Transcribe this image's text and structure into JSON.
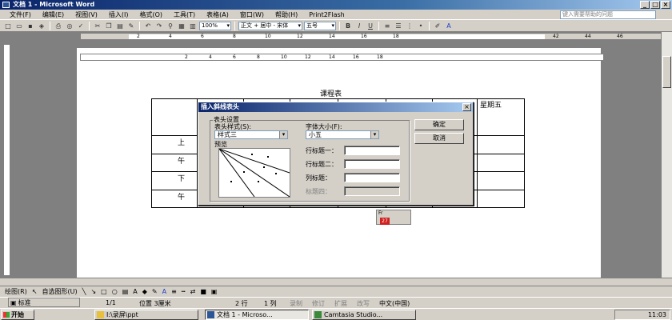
{
  "window": {
    "title": "文档 1 - Microsoft Word"
  },
  "menu": [
    "文件(F)",
    "编辑(E)",
    "视图(V)",
    "插入(I)",
    "格式(O)",
    "工具(T)",
    "表格(A)",
    "窗口(W)",
    "帮助(H)",
    "Print2Flash"
  ],
  "help_box": "键入需要帮助的问题",
  "toolbar": {
    "zoom": "100%",
    "style": "正文 + 居中 - 宋体",
    "font_size": "五号",
    "bold": "B",
    "italic": "I",
    "underline": "U"
  },
  "ruler_numbers": [
    "2",
    "4",
    "6",
    "8",
    "10",
    "12",
    "14",
    "16",
    "18",
    "42",
    "44",
    "46"
  ],
  "ruler2_numbers": [
    "2",
    "4",
    "6",
    "8",
    "10",
    "12",
    "14",
    "16",
    "18"
  ],
  "document": {
    "title": "课程表",
    "last_column_header": "星期五",
    "row_labels": [
      "上",
      "午",
      "下",
      "午"
    ]
  },
  "dialog": {
    "title": "插入斜线表头",
    "group_label": "表头设置",
    "style_label": "表头样式(S):",
    "style_value": "样式三",
    "fontsize_label": "字体大小(F):",
    "fontsize_value": "小五",
    "preview_label": "预览",
    "row_title1_label": "行标题一：",
    "row_title2_label": "行标题二：",
    "col_title_label": "列标题：",
    "row_title4_label": "标题四：",
    "ok_button": "确定",
    "cancel_button": "取消"
  },
  "floating_toolbar": {
    "title": "Fr",
    "value": "27"
  },
  "drawing_toolbar": {
    "draw_label": "绘图(R)",
    "autoshape_label": "自选图形(U)"
  },
  "status": {
    "page": "1/1",
    "position": "位置 3厘米",
    "line": "2 行",
    "column": "1 列",
    "rec": "录制",
    "trk": "修订",
    "ext": "扩展",
    "ovr": "改写",
    "lang": "中文(中国)"
  },
  "ime": {
    "label": "标准"
  },
  "taskbar": {
    "start": "开始",
    "tasks": [
      "I:\\录屏\\ppt",
      "文档 1 - Microso...",
      "Camtasia Studio..."
    ],
    "clock": "11:03"
  }
}
